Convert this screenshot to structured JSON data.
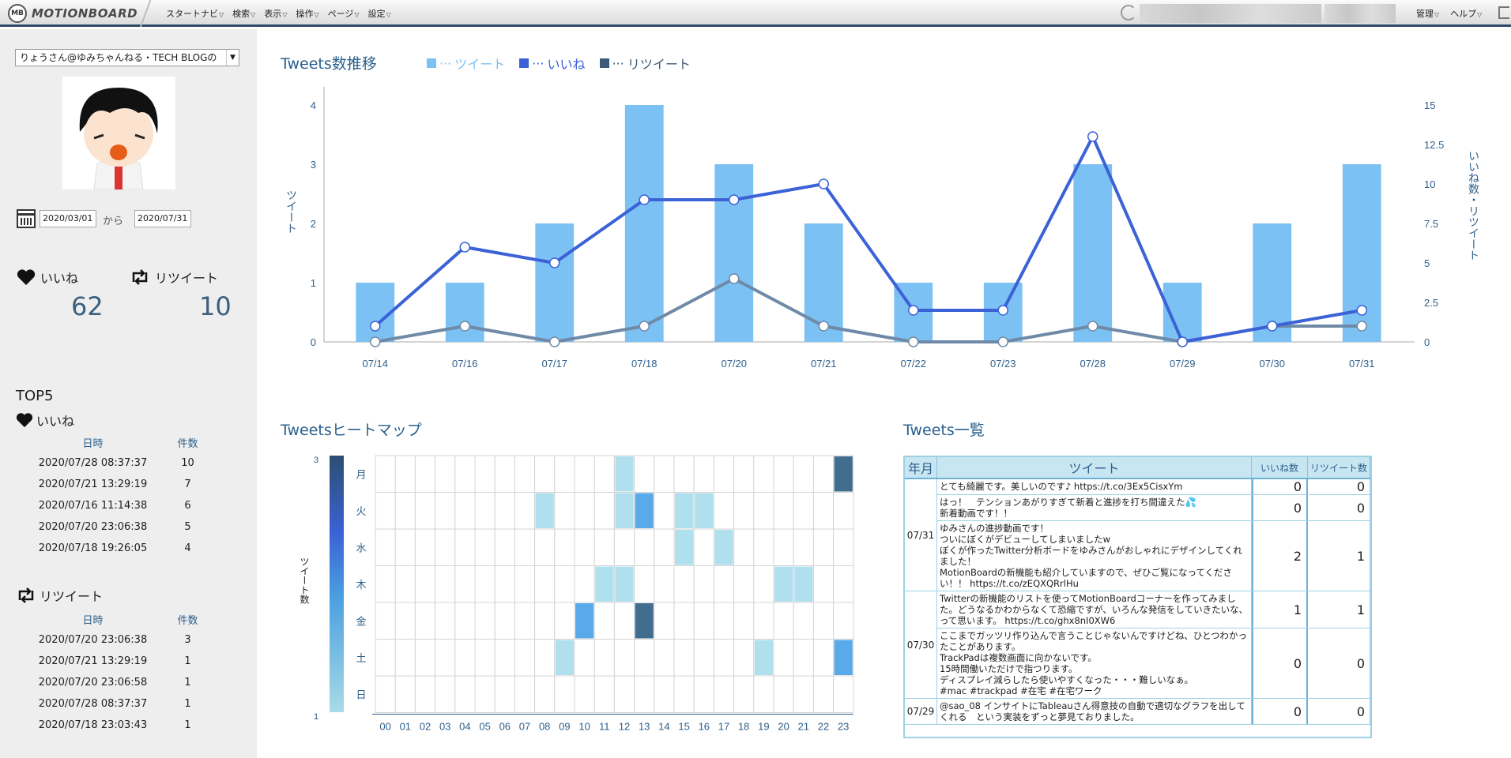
{
  "app": {
    "logo_badge": "MB",
    "logo_text": "MOTIONBOARD",
    "menu": [
      "スタートナビ",
      "検索",
      "表示",
      "操作",
      "ページ",
      "設定"
    ],
    "right_menu": [
      "管理",
      "ヘルプ"
    ]
  },
  "sidebar": {
    "account_select": "りょうさん@ゆみちゃんねる・TECH BLOGの",
    "date_from": "2020/03/01",
    "date_sep": "から",
    "date_to": "2020/07/31",
    "likes_label": "いいね",
    "likes_value": "62",
    "retweets_label": "リツイート",
    "retweets_value": "10",
    "top5_title": "TOP5",
    "top_likes": {
      "title": "いいね",
      "col_date": "日時",
      "col_count": "件数",
      "rows": [
        {
          "date": "2020/07/28 08:37:37",
          "count": "10"
        },
        {
          "date": "2020/07/21 13:29:19",
          "count": "7"
        },
        {
          "date": "2020/07/16 11:14:38",
          "count": "6"
        },
        {
          "date": "2020/07/20 23:06:38",
          "count": "5"
        },
        {
          "date": "2020/07/18 19:26:05",
          "count": "4"
        }
      ]
    },
    "top_retweets": {
      "title": "リツイート",
      "col_date": "日時",
      "col_count": "件数",
      "rows": [
        {
          "date": "2020/07/20 23:06:38",
          "count": "3"
        },
        {
          "date": "2020/07/21 13:29:19",
          "count": "1"
        },
        {
          "date": "2020/07/20 23:06:58",
          "count": "1"
        },
        {
          "date": "2020/07/28 08:37:37",
          "count": "1"
        },
        {
          "date": "2020/07/18 23:03:43",
          "count": "1"
        }
      ]
    }
  },
  "trend": {
    "title": "Tweets数推移",
    "legend": [
      {
        "label": "ツイート",
        "color": "#7cc1f3"
      },
      {
        "label": "いいね",
        "color": "#3b62d6"
      },
      {
        "label": "リツイート",
        "color": "#3b5b78"
      }
    ]
  },
  "heatmap_panel": {
    "title": "Tweetsヒートマップ",
    "colorbar_label": "ツイート数",
    "colorbar_max": "3",
    "colorbar_min": "1"
  },
  "tweets_panel": {
    "title": "Tweets一覧",
    "headers": {
      "month": "年月",
      "tweet": "ツイート",
      "likes": "いいね数",
      "retweets": "リツイート数"
    },
    "groups": [
      {
        "month": "07/31",
        "rows": [
          0,
          1,
          2
        ]
      },
      {
        "month": "07/30",
        "rows": [
          3,
          4
        ]
      },
      {
        "month": "07/29",
        "rows": [
          5
        ]
      }
    ],
    "rows": [
      {
        "text": "とても綺麗です。美しいのです♪ https://t.co/3Ex5CisxYm",
        "likes": "0",
        "retweets": "0"
      },
      {
        "text": "はっ！　テンションあがりすぎて新着と進捗を打ち間違えた💦\n新着動画です！！",
        "likes": "0",
        "retweets": "0"
      },
      {
        "text": "ゆみさんの進捗動画です！\nついにぼくがデビューしてしまいましたw\nぼくが作ったTwitter分析ボードをゆみさんがおしゃれにデザインしてくれました！\nMotionBoardの新機能も紹介していますので、ぜひご覧になってください！！ https://t.co/zEQXQRrlHu",
        "likes": "2",
        "retweets": "1"
      },
      {
        "text": "Twitterの新機能のリストを使ってMotionBoardコーナーを作ってみました。どうなるかわからなくて恐縮ですが、いろんな発信をしていきたいな、って思います。 https://t.co/ghx8nI0XW6",
        "likes": "1",
        "retweets": "1"
      },
      {
        "text": "ここまでガッツリ作り込んで言うことじゃないんですけどね、ひとつわかったことがあります。\nTrackPadは複数画面に向かないです。\n15時間働いただけで指つります。\nディスプレイ減らしたら使いやすくなった・・・難しいなぁ。\n#mac #trackpad #在宅 #在宅ワーク",
        "likes": "0",
        "retweets": "0"
      },
      {
        "text": "@sao_08 インサイトにTableauさん得意技の自動で適切なグラフを出してくれる　という実装をずっと夢見ておりました。",
        "likes": "0",
        "retweets": "0"
      }
    ]
  },
  "chart_data": [
    {
      "type": "bar",
      "title": "Tweets数推移",
      "categories": [
        "07/14",
        "07/16",
        "07/17",
        "07/18",
        "07/20",
        "07/21",
        "07/22",
        "07/23",
        "07/28",
        "07/29",
        "07/30",
        "07/31"
      ],
      "ylabel": "ツイート",
      "y2label": "いいね数・リツイート",
      "ylim": [
        0,
        4
      ],
      "y2lim": [
        0,
        15
      ],
      "yticks": [
        "0",
        "1",
        "2",
        "3",
        "4"
      ],
      "y2ticks": [
        "0",
        "2.5",
        "5",
        "7.5",
        "10",
        "12.5",
        "15"
      ],
      "series": [
        {
          "name": "ツイート",
          "kind": "bar",
          "axis": "left",
          "values": [
            1,
            1,
            2,
            4,
            3,
            2,
            1,
            1,
            3,
            1,
            2,
            3
          ]
        },
        {
          "name": "いいね",
          "kind": "line",
          "axis": "right",
          "values": [
            1,
            6,
            5,
            9,
            9,
            10,
            2,
            2,
            13,
            0,
            1,
            2
          ]
        },
        {
          "name": "リツイート",
          "kind": "line",
          "axis": "right",
          "values": [
            0,
            1,
            0,
            1,
            4,
            1,
            0,
            0,
            1,
            0,
            1,
            1
          ]
        }
      ]
    },
    {
      "type": "heatmap",
      "title": "Tweetsヒートマップ",
      "rows": [
        "月",
        "火",
        "水",
        "木",
        "金",
        "土",
        "日"
      ],
      "columns": [
        "00",
        "01",
        "02",
        "03",
        "04",
        "05",
        "06",
        "07",
        "08",
        "09",
        "10",
        "11",
        "12",
        "13",
        "14",
        "15",
        "16",
        "17",
        "18",
        "19",
        "20",
        "21",
        "22",
        "23"
      ],
      "zlim": [
        1,
        3
      ],
      "cells": [
        {
          "row": "月",
          "col": "12",
          "value": 1
        },
        {
          "row": "月",
          "col": "23",
          "value": 3
        },
        {
          "row": "火",
          "col": "08",
          "value": 1
        },
        {
          "row": "火",
          "col": "12",
          "value": 1
        },
        {
          "row": "火",
          "col": "13",
          "value": 2
        },
        {
          "row": "火",
          "col": "15",
          "value": 1
        },
        {
          "row": "火",
          "col": "16",
          "value": 1
        },
        {
          "row": "水",
          "col": "15",
          "value": 1
        },
        {
          "row": "水",
          "col": "17",
          "value": 1
        },
        {
          "row": "木",
          "col": "11",
          "value": 1
        },
        {
          "row": "木",
          "col": "12",
          "value": 1
        },
        {
          "row": "木",
          "col": "20",
          "value": 1
        },
        {
          "row": "木",
          "col": "21",
          "value": 1
        },
        {
          "row": "金",
          "col": "10",
          "value": 2
        },
        {
          "row": "金",
          "col": "13",
          "value": 3
        },
        {
          "row": "土",
          "col": "09",
          "value": 1
        },
        {
          "row": "土",
          "col": "19",
          "value": 1
        },
        {
          "row": "土",
          "col": "23",
          "value": 2
        }
      ]
    }
  ]
}
